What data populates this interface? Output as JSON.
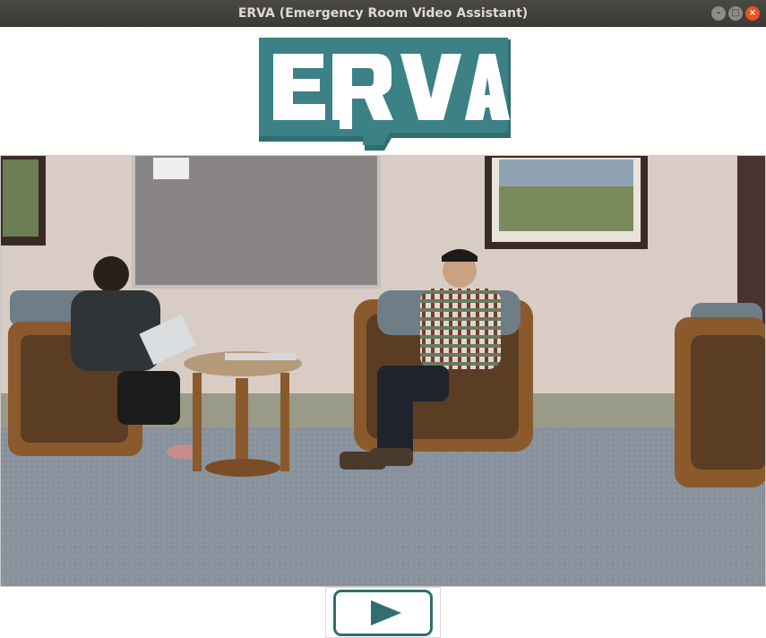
{
  "window": {
    "title": "ERVA (Emergency Room Video Assistant)",
    "controls": [
      "minimize",
      "maximize",
      "close"
    ]
  },
  "logo": {
    "text": "ERVA",
    "colors": {
      "fill": "#ffffff",
      "outline": "#3b8185",
      "shadow": "#2f6e71"
    }
  },
  "video": {
    "description_icon": "video-frame",
    "colors": {
      "wall": "#d9ccc4",
      "carpet": "#8e99a3",
      "bulletin_board": "#8a8585"
    }
  },
  "controls": {
    "play_icon": "play-icon",
    "accent": "#2f6e71"
  },
  "window_controls_glyphs": {
    "minimize": "–",
    "maximize": "□",
    "close": "×"
  }
}
